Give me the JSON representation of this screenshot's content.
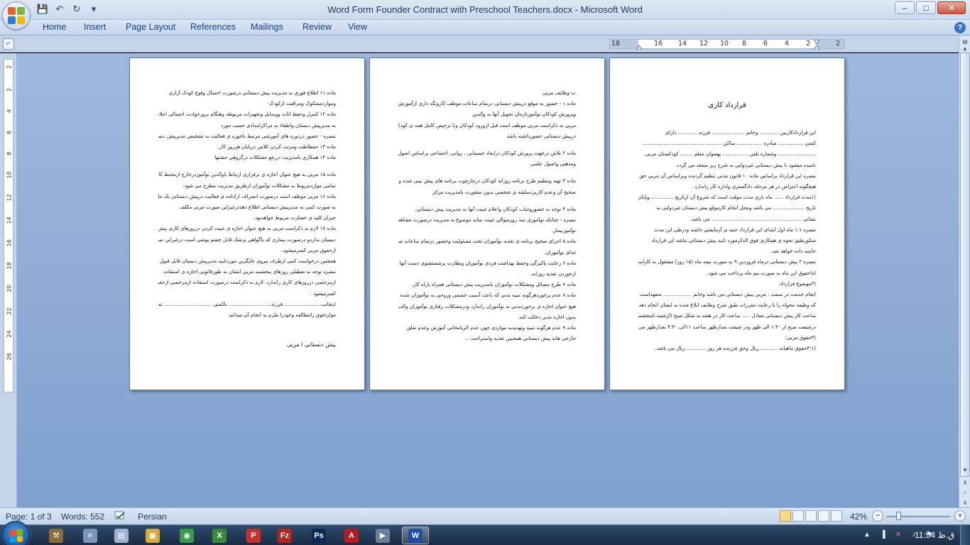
{
  "window": {
    "title": "Word Form Founder Contract with Preschool Teachers.docx - Microsoft Word",
    "controls": {
      "minimize": "–",
      "maximize": "□",
      "close": "✕"
    }
  },
  "quick_access": {
    "save_icon": "💾",
    "undo_icon": "↶",
    "redo_icon": "↻",
    "customize_icon": "▾"
  },
  "ribbon": {
    "tabs": [
      "Home",
      "Insert",
      "Page Layout",
      "References",
      "Mailings",
      "Review",
      "View"
    ],
    "help_icon": "?"
  },
  "ruler": {
    "labels": [
      "18",
      "16",
      "14",
      "12",
      "10",
      "8",
      "6",
      "4",
      "2",
      "2"
    ]
  },
  "vertical_ruler": {
    "labels": [
      "2",
      "2",
      "4",
      "6",
      "8",
      "10",
      "12",
      "14",
      "16",
      "18",
      "20",
      "22",
      "24",
      "26"
    ]
  },
  "pages": [
    {
      "title": "قرارداد کاری",
      "lines": [
        "این قراردادکاربین ............ وخانم ..................... فرزند ............ دارای",
        "کمتی ................ صادره ................ ساکن ..................................................",
        "........................ وشماره تلفن ................ بهعنوان معلم ........ کودکستان مربی",
        "نامیده میشود با پیش دبستانی غیردولتی به شرح زیر منعقد می گردد.",
        "تبصره این قرارداد براساس ماده ۱۰ قانون مدنی تنظیم گردیده وبراساس آن مربی حق",
        "هیچگونه اعتراض در هر مرحله دادگستری واداره کار راندارد .",
        "(۱مدت قرارداد ...... ماه باری مدت موقت است که شروع آن ازتاریخ .............. وپایان آن",
        "تاریخ .................... می باشد ومحل انجام کارموقع پیش دبستان غیردولتی به",
        "نشانی ......................................................... می باشد.",
        "تبصره ۱:۱ ماه اول ابتدای این قرارداد جنبه ی آزمایشی داشته ودرطی این مدت",
        "منکورطبق نحوه ی همکاری فوق الذکرمورد تایید پیش دبستانی نباشد این قرارداد",
        "خاتمه داده خواهد شد.",
        "تبصره ۲ پیش دبستانی درماه فروردین ۹ به صورت نیمه ماه (۱۵ روز) مشغول به کاراست",
        "لذاحقوق این ماه به صورت نیم ماه پرداخت می شود.",
        "(۲موضوع قرارداد:",
        "انجام خدمت در سمت : مربی پیش دبستانی می باشد وخانم .................. متعهداست",
        "که وظیفه محوله را با رعایت مقررات طبق شرح وظایف ابلاغ شده به ایشان انجام دهد",
        "ساعت کار پیش دبستانی معادل ..... ساعت کار در هفته به شکل صبح (ازشنبه تاپنجشنبه)",
        "درشیفت صبح از ۱:۳۰ الی ظهر ودر شیفت بعدازظهر ساعت ۱۱الی ۴:۳۰ بعدازظهر می باشد .",
        "(۳حقوق مربی:",
        "(۳-۱حقوق ماهیانه ........... ریال وحق فرزنده هر روز ............ ریال می باشد."
      ]
    },
    {
      "title": "",
      "lines": [
        "ب-وظایف مربی",
        "ماده ۱ - حضور به موقع درپیش دبستانی درتمام ساعات موظف کارونگه داری ازآموزش",
        "وپرورش کودکان نوآموزتازمان تحویل آنها به والدین",
        "مربی به ذکراست مربی موظف است قبل ازورود کودکان وتا ترخیص کامل همه ی کودکان",
        "درپیش دبستانی حضورداشته باشد",
        "",
        "ماده ۲ تلاش درجهت پرورش کودکان درابعاد جسمانی ، روانی، اجتماعی براساس اصول دینی",
        "ومذهبی واصول علمی.",
        "",
        "ماده ۳ تهیه وتنظیم طرح برنامه روزانه کودکان درچارچوب برنامه های پیش بینی شده واجرای",
        "صحیح آن وعدم کاربردسلیقه ی شخصی بدون مشورت بامدیریت مرکز",
        "",
        "ماده ۴ توجه به حضوروغیاب کودکان واعلام غیبت آنها به مدیریت پیش دبستانی.",
        "تبصره - چنانکه نوآموزی سه روزمتوالی غیبت نماید موضوع به مدیریت درصورت مشاهده",
        "نوآموزبیمار.",
        "ماده ۵ اجرای صحیح برنامه ی تغذیه نوآموزان تحت مسئولیت وحضور درتمام ساعات صرف",
        "غذای نوآموزان.",
        "ماده ۶ رعایت پاکیزگی وحفظ بهداشت فردی نوآموزان ونظارت برشستشوی دست آنها قبل",
        "ازخوردن تغذیه روزانه.",
        "ماده ۷ طرح مسائل ومشکلات نوآموزان بامدیریت پیش دبستانی همراه باراه کار.",
        "ماده ۸ عدم برخوردهرگونه تنبیه بدنی که باعث آسیب جسمی وروحی به نوآموزان شده منتی مربی به",
        "هیچ عنوان اجازه ی برخوردبدنی به نوآموزان راندارد ودرمشکلات رفتاری نوآموزان والدین",
        "بدون اجازه مدیر دخالت کند.",
        "ماده ۹ عدم هرگونه تنبیه وتهدیدبه مواردی چون عدم الریامخانی آموزش وعدم تعلق",
        "جازخی هابه پیش دبستانی همچنین تغذیه واستراحت ..."
      ]
    },
    {
      "title": "",
      "lines": [
        "ماده ۱۱ اطلاع فوری به مدیریت پیش دبستانی درصورت احتمال وقوع کودک آزاری",
        "ومواردمشکوک ومراقبت ازکودک",
        "ماده ۱۲ کنترل وحفظ اثاث ووسایل وتجهیزات مربوطه وهنگام بروزحوادث احتمالی اعلام فوری",
        "به مدیرپیش دبستان واطفاء به مراکزامدادی حسب مورد",
        "تبصره - حضور دردوره های آموزشی مرتبط باحوزه ی فعالیت به تشخیص مدیرپیش دبستان.",
        "ماده ۱۳ حفظاظت ومرتب کردن کلاس درپایان هرروز کار.",
        "ماده ۱۴ همکاری بامدیریت دررفع مشکلات درگروهی جشنها",
        "",
        "ماده ۱۵ مربی به هیچ عنوان اجازه ی برقراری ارتباط باوالدین نوآموزدرخارج ازمحیط کارراندارد.",
        "تمامی مواردمربوط به مشکلات نوآموزان ازطریق مدیریت مطرح می شود.",
        "ماده ۱۶ مربی موظف است درصورت انصراف ازادامه ی فعالیت درپیش دبستانی یک ماه قبل",
        "به صورت کتبی به مدیرپیش دبستانی اطلاع دهددرغیراین صورت مربی مکلف",
        "جبران کلیه ی خسارت مربوط خواهدبود.",
        "ماده ۱۷ لازم به ذکراست مربی به هیچ عنوان اجازه ی غیبت کردن درروزهای کاری پیش",
        "دبستان نداردو درصورت بیماری که باگواهی پزشک قابل چشم پوشی است درغیراین صورت",
        "ازحقوق مربی کسرمیشود.",
        "همچنین درخواست کتبی ازطرف نیروی جایگزین موردتایید مدیرپیش دبستان قابل قبول است .",
        "تبصره توجه به تعطیلی روزهای پنجشنبه مربی ایشان به طورقانونی اجازه ی استفاده",
        "ازمرخصی درروزهای کاری راندارد. لازم به ذکراست درصورت استفاده ازمرخصی ازحقوق مربی",
        "کسرمیشود .",
        "اینجانب ...................... فرزند .......................... باکمتی .............................. تمامی",
        "مواردفوق رامطالعه وخودرا ملزم به انجام آن میدانم."
      ],
      "signature": "پیش دبستانی   ا مربی"
    }
  ],
  "status": {
    "page": "Page: 1 of 3",
    "words": "Words: 552",
    "language": "Persian",
    "zoom": "42%"
  },
  "taskbar": {
    "clock": "11:54 ق.ظ",
    "apps": [
      {
        "name": "tools",
        "glyph": "⚒",
        "color": "#8a6d3b"
      },
      {
        "name": "notepad",
        "glyph": "≡",
        "color": "#7b96b8"
      },
      {
        "name": "document-viewer",
        "glyph": "▤",
        "color": "#9fb3cc"
      },
      {
        "name": "file-explorer",
        "glyph": "▣",
        "color": "#d9a93a"
      },
      {
        "name": "chrome",
        "glyph": "◉",
        "color": "#3a9a4a"
      },
      {
        "name": "excel-like",
        "glyph": "X",
        "color": "#3b8a3e"
      },
      {
        "name": "pinnacle",
        "glyph": "P",
        "color": "#c9302c"
      },
      {
        "name": "filezilla",
        "glyph": "Fz",
        "color": "#b3261e"
      },
      {
        "name": "photoshop",
        "glyph": "Ps",
        "color": "#0b2a55"
      },
      {
        "name": "acrobat",
        "glyph": "A",
        "color": "#b71c1c"
      },
      {
        "name": "media-player",
        "glyph": "▶",
        "color": "#6b7f99"
      },
      {
        "name": "word",
        "glyph": "W",
        "color": "#1f4fa0"
      }
    ],
    "tray": [
      "▲",
      "▐",
      "✕",
      "♪",
      "⚑"
    ]
  }
}
